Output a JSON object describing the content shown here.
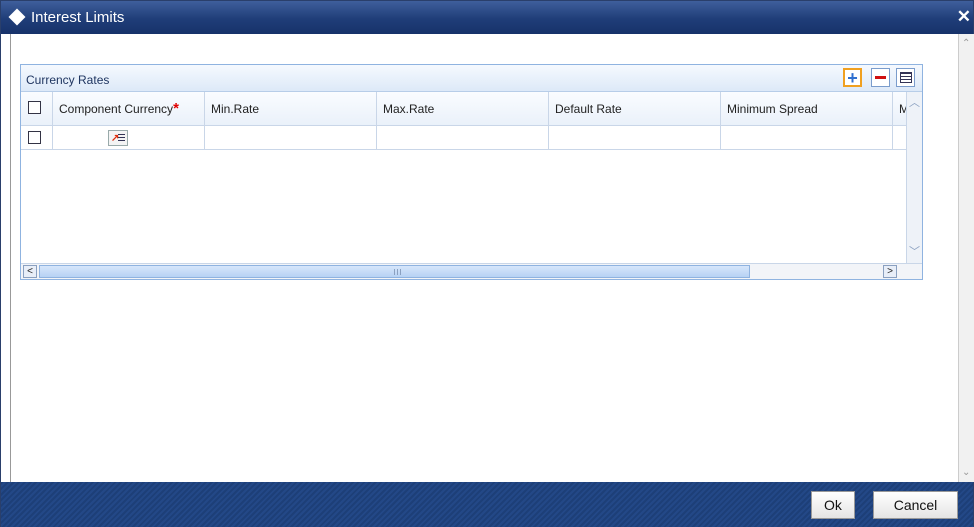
{
  "window": {
    "title": "Interest Limits",
    "close_glyph": "✕"
  },
  "panel": {
    "title": "Currency Rates",
    "toolbar": {
      "add_icon": "plus-icon",
      "delete_icon": "minus-icon",
      "view_icon": "list-icon"
    }
  },
  "grid": {
    "columns": [
      "Component Currency",
      "Min.Rate",
      "Max.Rate",
      "Default Rate",
      "Minimum Spread",
      "M"
    ],
    "required_marker": "*",
    "rows": [
      {
        "checked": false,
        "component_currency": "",
        "min_rate": "",
        "max_rate": "",
        "default_rate": "",
        "minimum_spread": ""
      }
    ]
  },
  "scrollbar": {
    "thumb_glyph": "III"
  },
  "footer": {
    "ok_label": "Ok",
    "cancel_label": "Cancel"
  },
  "colors": {
    "title_bar": "#1f3d78",
    "footer": "#1d3f78",
    "required": "#e00000",
    "panel_border": "#8fb3e0"
  }
}
